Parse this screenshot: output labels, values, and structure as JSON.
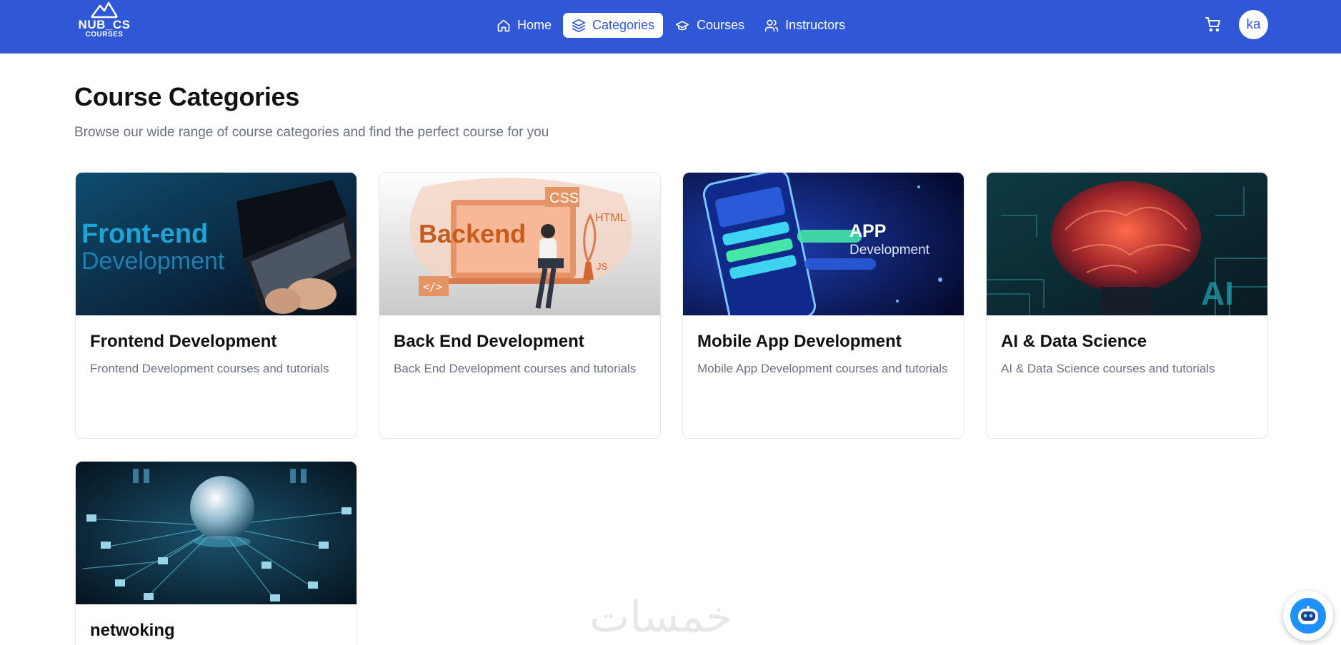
{
  "logo": {
    "line1": "NUB_CS",
    "line2": "COURSES"
  },
  "nav": {
    "items": [
      {
        "label": "Home",
        "icon": "home-icon",
        "active": false
      },
      {
        "label": "Categories",
        "icon": "layers-icon",
        "active": true
      },
      {
        "label": "Courses",
        "icon": "graduation-cap-icon",
        "active": false
      },
      {
        "label": "Instructors",
        "icon": "users-icon",
        "active": false
      }
    ]
  },
  "header": {
    "avatar_initials": "ka",
    "cart_icon": "cart-icon"
  },
  "page": {
    "title": "Course Categories",
    "subtitle": "Browse our wide range of course categories and find the perfect course for you"
  },
  "categories": [
    {
      "title": "Frontend Development",
      "description": "Frontend Development courses and tutorials",
      "image_text_1": "Front-end",
      "image_text_2": "Development"
    },
    {
      "title": "Back End Development",
      "description": "Back End Development courses and tutorials",
      "image_text_1": "Backend",
      "image_text_2": "CSS",
      "image_text_3": "HTML",
      "image_text_4": "JS",
      "image_text_5": "</>"
    },
    {
      "title": "Mobile App Development",
      "description": "Mobile App Development courses and tutorials",
      "image_text_1": "APP",
      "image_text_2": "Development"
    },
    {
      "title": "AI & Data Science",
      "description": "AI & Data Science courses and tutorials",
      "image_text_1": "AI"
    },
    {
      "title": "netwoking",
      "description": ""
    }
  ],
  "watermark": "خمسات",
  "colors": {
    "primary": "#2f57d6",
    "text": "#111111",
    "muted": "#6b7280",
    "border": "#e5e7eb",
    "chatbot": "#1e90ff"
  }
}
